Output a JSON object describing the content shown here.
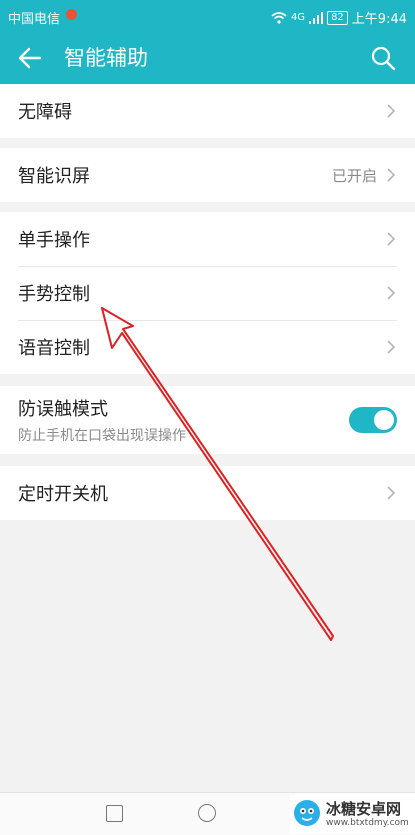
{
  "status_bar": {
    "carrier": "中国电信",
    "network": "4G",
    "battery": "82",
    "time": "上午9:44"
  },
  "app_bar": {
    "title": "智能辅助"
  },
  "settings": {
    "accessibility": {
      "label": "无障碍"
    },
    "smart_screen": {
      "label": "智能识屏",
      "value": "已开启"
    },
    "one_hand": {
      "label": "单手操作"
    },
    "gesture": {
      "label": "手势控制"
    },
    "voice": {
      "label": "语音控制"
    },
    "pocket_mode": {
      "label": "防误触模式",
      "sub": "防止手机在口袋出现误操作",
      "enabled": true
    },
    "scheduled_power": {
      "label": "定时开关机"
    }
  },
  "watermark": {
    "name": "冰糖安卓网",
    "url": "www.btxtdmy.com"
  },
  "colors": {
    "accent": "#1fb6c6",
    "annotation_arrow": "#e02020"
  }
}
